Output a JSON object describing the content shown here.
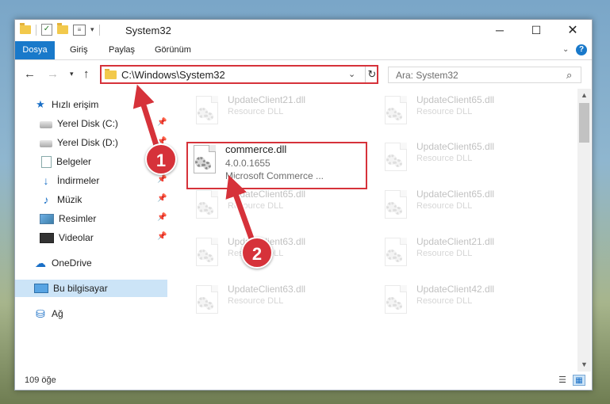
{
  "window": {
    "title": "System32",
    "controls": {
      "minimize": "─",
      "maximize": "☐",
      "close": "✕"
    }
  },
  "ribbon": {
    "tabs": [
      "Dosya",
      "Giriş",
      "Paylaş",
      "Görünüm"
    ],
    "active_tab": "Dosya",
    "help": "?",
    "accent_color": "#1979ca"
  },
  "address": {
    "path": "C:\\Windows\\System32",
    "search_placeholder": "Ara: System32"
  },
  "sidebar": {
    "items": [
      {
        "label": "Hızlı erişim",
        "icon": "star-icon"
      },
      {
        "label": "Yerel Disk (C:)",
        "icon": "disk-icon",
        "pinned": true
      },
      {
        "label": "Yerel Disk (D:)",
        "icon": "disk-icon",
        "pinned": true
      },
      {
        "label": "Belgeler",
        "icon": "documents-icon",
        "pinned": true
      },
      {
        "label": "İndirmeler",
        "icon": "download-icon",
        "pinned": true
      },
      {
        "label": "Müzik",
        "icon": "music-icon",
        "pinned": true
      },
      {
        "label": "Resimler",
        "icon": "pictures-icon",
        "pinned": true
      },
      {
        "label": "Videolar",
        "icon": "videos-icon",
        "pinned": true
      },
      {
        "label": "OneDrive",
        "icon": "cloud-icon"
      },
      {
        "label": "Bu bilgisayar",
        "icon": "computer-icon",
        "selected": true
      },
      {
        "label": "Ağ",
        "icon": "network-icon"
      }
    ]
  },
  "files": {
    "highlighted": {
      "name": "commerce.dll",
      "version": "4.0.0.1655",
      "description": "Microsoft Commerce ..."
    },
    "background": [
      {
        "name": "UpdateClient21.dll",
        "type": "Resource DLL"
      },
      {
        "name": "UpdateClient65.dll",
        "type": "Resource DLL"
      },
      {
        "name": "UpdateClient65.dll",
        "type": "Resource DLL"
      },
      {
        "name": "UpdateClient65.dll",
        "type": "Resource DLL"
      },
      {
        "name": "UpdateClient65.dll",
        "type": "Resource DLL"
      },
      {
        "name": "UpdateClient63.dll",
        "type": "Resource DLL"
      },
      {
        "name": "UpdateClient21.dll",
        "type": "Resource DLL"
      },
      {
        "name": "UpdateClient63.dll",
        "type": "Resource DLL"
      },
      {
        "name": "UpdateClient42.dll",
        "type": "Resource DLL"
      }
    ]
  },
  "status": {
    "item_count": "109 öğe"
  },
  "annotations": {
    "step1": "1",
    "step2": "2",
    "color": "#d6323a"
  }
}
